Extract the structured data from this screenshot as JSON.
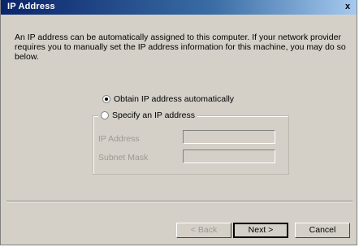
{
  "window": {
    "title": "IP Address",
    "close_glyph": "x"
  },
  "description": "An IP address can be automatically assigned to this computer. If your network provider requires you to manually set the IP address information for this machine, you may do so below.",
  "options": {
    "auto_label": "Obtain IP address automatically",
    "auto_selected": true,
    "specify_label": "Specify an IP address",
    "specify_selected": false
  },
  "fields": {
    "ip_label": "IP Address",
    "ip_value": "",
    "mask_label": "Subnet Mask",
    "mask_value": ""
  },
  "buttons": {
    "back_label": "< Back",
    "next_label": "Next >",
    "cancel_label": "Cancel"
  }
}
